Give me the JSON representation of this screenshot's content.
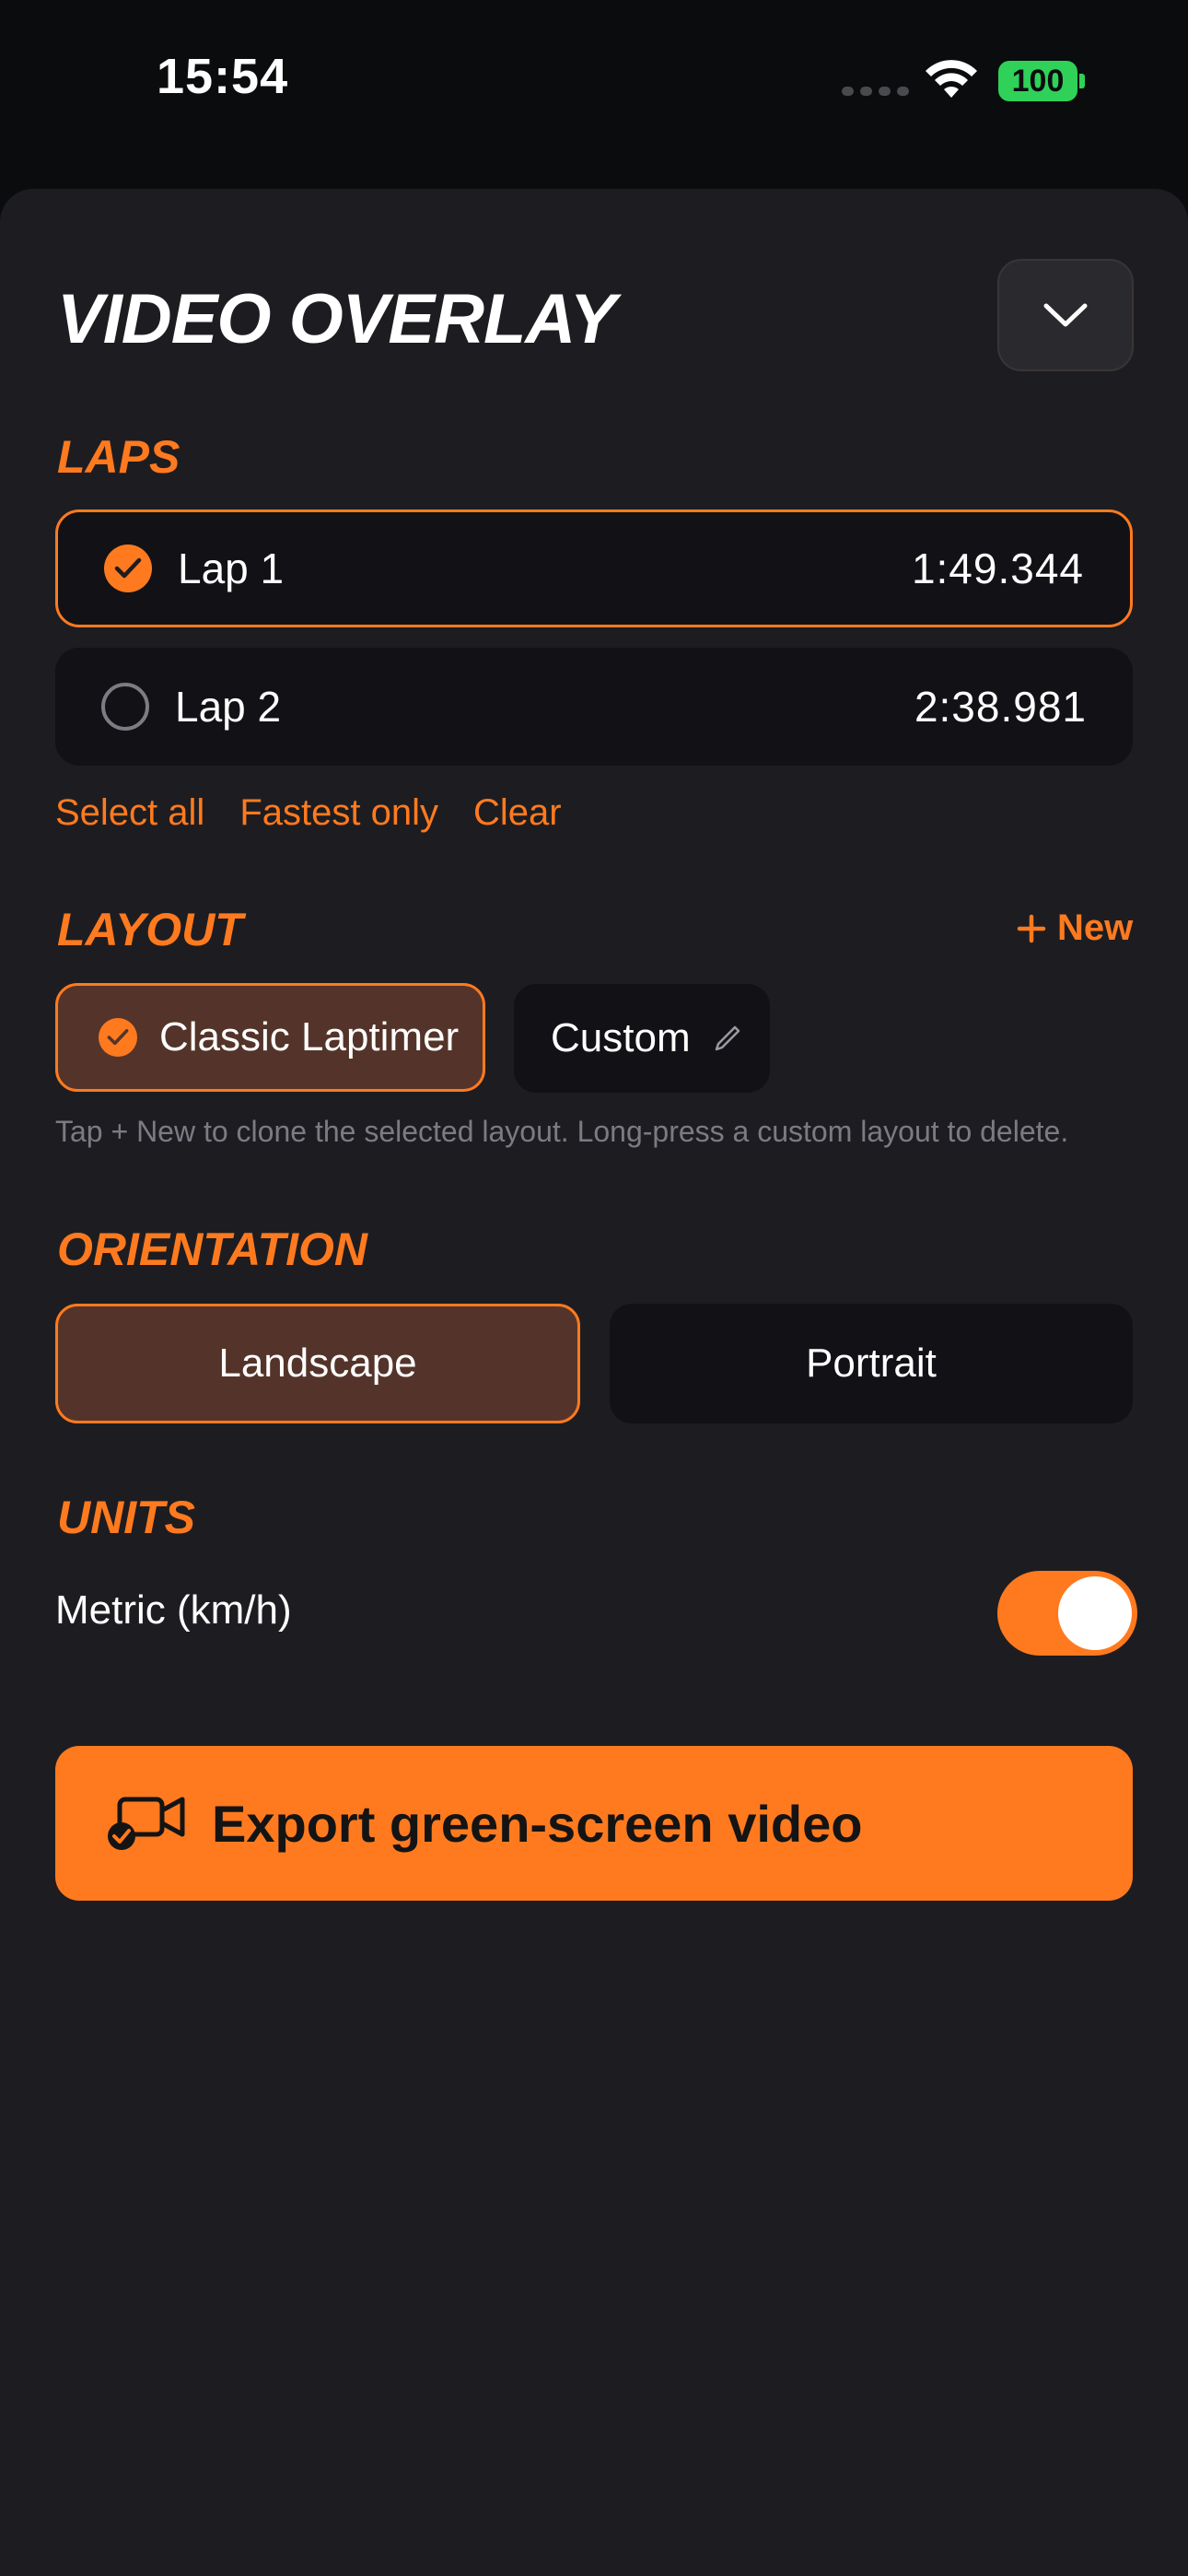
{
  "status": {
    "time": "15:54",
    "battery": "100"
  },
  "sheet": {
    "title": "VIDEO OVERLAY"
  },
  "laps": {
    "label": "LAPS",
    "items": [
      {
        "name": "Lap 1",
        "time": "1:49.344",
        "selected": true
      },
      {
        "name": "Lap 2",
        "time": "2:38.981",
        "selected": false
      }
    ],
    "actions": [
      "Select all",
      "Fastest only",
      "Clear"
    ]
  },
  "layout": {
    "label": "LAYOUT",
    "new_label": "New",
    "options": [
      {
        "label": "Classic Laptimer",
        "selected": true
      },
      {
        "label": "Custom",
        "selected": false
      }
    ],
    "helper": "Tap + New to clone the selected layout. Long-press a custom layout to delete."
  },
  "orientation": {
    "label": "ORIENTATION",
    "options": [
      {
        "label": "Landscape",
        "selected": true
      },
      {
        "label": "Portrait",
        "selected": false
      }
    ]
  },
  "units": {
    "label": "UNITS",
    "setting": "Metric (km/h)",
    "enabled": true
  },
  "export": {
    "label": "Export green-screen video"
  },
  "colors": {
    "accent": "#ff7a1f",
    "background": "#1d1d21",
    "card": "#121216",
    "battery": "#2fd158"
  }
}
